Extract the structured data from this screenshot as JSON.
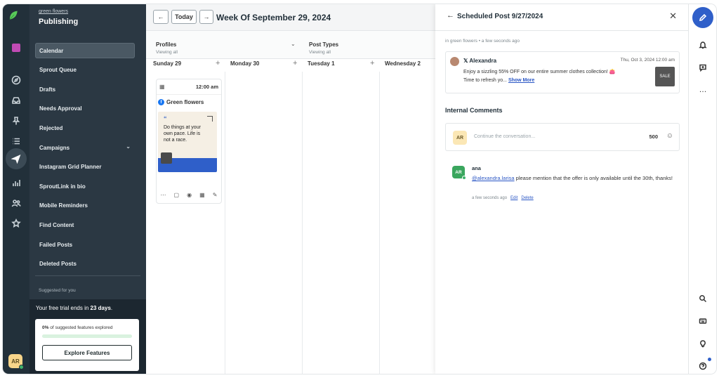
{
  "colors": {
    "rail_bg": "#22303a",
    "panel_bg": "#2b3843",
    "accent_blue": "#2f5fc9",
    "brand_green": "#40b36b",
    "link": "#2b57c5"
  },
  "left_rail": {
    "icons": [
      "sprout-leaf-logo",
      "publishing-icon",
      "compass-icon",
      "inbox-icon",
      "pin-icon",
      "list-icon",
      "send-icon",
      "bar-chart-icon",
      "people-icon",
      "star-badge-icon"
    ],
    "user_initials": "AR"
  },
  "sidebar": {
    "org": "green flowers",
    "title": "Publishing",
    "items": [
      {
        "label": "Calendar",
        "active": true
      },
      {
        "label": "Sprout Queue"
      },
      {
        "label": "Drafts"
      },
      {
        "label": "Needs Approval"
      },
      {
        "label": "Rejected"
      },
      {
        "label": "Campaigns"
      },
      {
        "label": "Instagram Grid Planner"
      },
      {
        "label": "SproutLink in bio"
      },
      {
        "label": "Mobile Reminders"
      },
      {
        "label": "Find Content"
      },
      {
        "label": "Failed Posts"
      },
      {
        "label": "Deleted Posts"
      }
    ],
    "suggested_label": "Suggested for you",
    "trial": {
      "prefix": "Your free trial ends in ",
      "days": "23 days",
      "suffix": ".",
      "progress_pct": "0%",
      "progress_text": " of suggested features explored",
      "progress_fraction": 0.0,
      "button": "Explore Features"
    }
  },
  "calendar": {
    "today_label": "Today",
    "prev_icon": "arrow-left-icon",
    "next_icon": "arrow-right-icon",
    "week_title": "Week Of September 29, 2024",
    "filters": {
      "profiles_label": "Profiles",
      "profiles_value": "Viewing all",
      "post_types_label": "Post Types",
      "post_types_value": "Viewing all"
    },
    "days": [
      "Sunday 29",
      "Monday 30",
      "Tuesday 1",
      "Wednesday 2"
    ],
    "post": {
      "time": "12:00 am",
      "profile": "Green flowers",
      "network": "facebook-icon",
      "quote": "Do things at your own pace. Life is not a race.",
      "quote_mark": "“"
    }
  },
  "modal": {
    "back_icon": "arrow-left-icon",
    "title": "Scheduled Post 9/27/2024",
    "close_icon": "close-icon",
    "meta": "in green flowers • a few seconds ago",
    "tweet": {
      "network_glyph": "𝕏",
      "author": "Alexandra",
      "date": "Thu, Oct 3, 2024 12:00 am",
      "line1": "Enjoy a sizzling 55% OFF on our entire summer clothes collection! 👛",
      "line2": "Time to refresh yo...",
      "show_more": "Show More",
      "thumb_text": "SALE"
    },
    "internal_comments_title": "Internal Comments",
    "composer": {
      "initials": "AR",
      "placeholder": "Continue the conversation...",
      "char_count": "500"
    },
    "comment": {
      "initials": "AR",
      "author": "ana",
      "mention": "@alexandra.larisa",
      "text": " please mention that the offer is only available until the 30th, thanks!",
      "time": "a few seconds ago",
      "edit": "Edit",
      "delete": "Delete"
    }
  },
  "right_rail": {
    "icons": [
      "compose-icon",
      "bell-icon",
      "chat-plus-icon",
      "more-icon",
      "search-icon",
      "keyboard-icon",
      "lightbulb-icon",
      "help-icon"
    ],
    "more_glyph": "…"
  }
}
